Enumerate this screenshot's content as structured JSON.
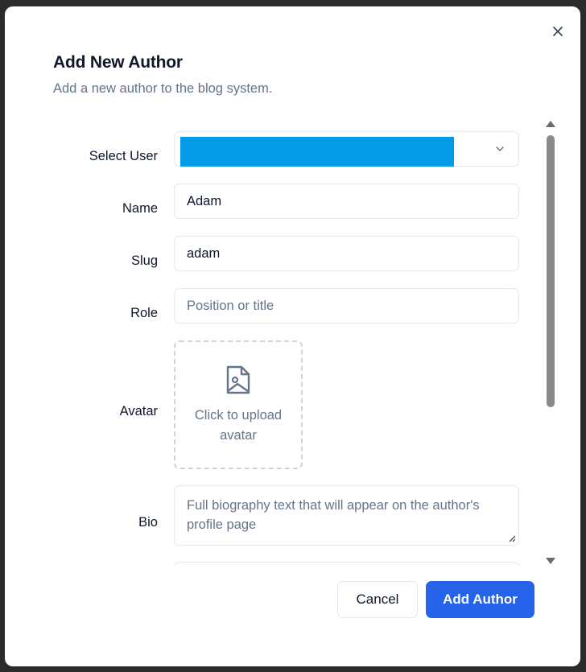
{
  "dialog": {
    "title": "Add New Author",
    "subtitle": "Add a new author to the blog system."
  },
  "form": {
    "select_user": {
      "label": "Select User",
      "value": ""
    },
    "name": {
      "label": "Name",
      "value": "Adam"
    },
    "slug": {
      "label": "Slug",
      "value": "adam"
    },
    "role": {
      "label": "Role",
      "placeholder": "Position or title"
    },
    "avatar": {
      "label": "Avatar",
      "upload_text": "Click to upload avatar"
    },
    "bio": {
      "label": "Bio",
      "placeholder": "Full biography text that will appear on the author's profile page"
    }
  },
  "buttons": {
    "cancel": "Cancel",
    "add": "Add Author"
  },
  "colors": {
    "primary": "#2563eb",
    "select_highlight": "#039be5",
    "muted_text": "#64748b",
    "border": "#e2e8f0"
  },
  "icons": {
    "close": "close-icon",
    "chevron": "chevron-down-icon",
    "image_upload": "image-upload-icon"
  }
}
